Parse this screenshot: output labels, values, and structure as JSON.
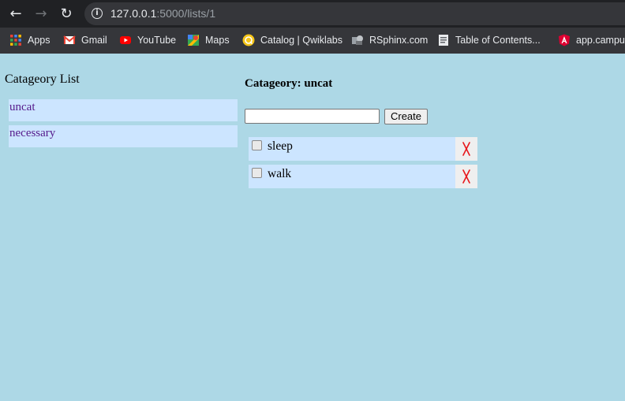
{
  "browser": {
    "url_host": "127.0.0.1",
    "url_path": ":5000/lists/1",
    "bookmarks": [
      {
        "label": "Apps",
        "icon": "apps-grid-icon"
      },
      {
        "label": "Gmail",
        "icon": "gmail-icon"
      },
      {
        "label": "YouTube",
        "icon": "youtube-icon"
      },
      {
        "label": "Maps",
        "icon": "maps-icon"
      },
      {
        "label": "Catalog | Qwiklabs",
        "icon": "qwiklabs-icon"
      },
      {
        "label": "RSphinx.com",
        "icon": "rsphinx-icon"
      },
      {
        "label": "Table of Contents...",
        "icon": "document-icon"
      },
      {
        "label": "app.campus",
        "icon": "angular-icon"
      }
    ]
  },
  "sidebar": {
    "heading": "Catageory List",
    "items": [
      {
        "label": "uncat"
      },
      {
        "label": "necessary"
      }
    ]
  },
  "main": {
    "title": "Catageory: uncat",
    "create_label": "Create",
    "input_value": "",
    "todos": [
      {
        "text": "sleep",
        "done": false
      },
      {
        "text": "walk",
        "done": false
      }
    ]
  },
  "colors": {
    "page_bg": "#add8e6",
    "item_bg": "#cce5ff",
    "link": "#551a8b",
    "delete_x": "#e8171b"
  }
}
